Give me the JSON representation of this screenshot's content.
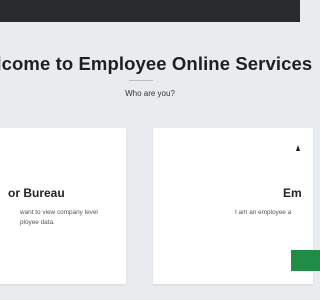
{
  "header": {
    "title": "elcome to Employee Online Services",
    "subtitle": "Who are you?"
  },
  "cards": {
    "left": {
      "heading": "or Bureau",
      "description_line1": "want to view company level",
      "description_line2": "ployee data."
    },
    "right": {
      "heading": "Em",
      "description_line1": "I am an employee a",
      "icon": "person-icon"
    }
  },
  "colors": {
    "topbar": "#282a2e",
    "background": "#e8ecee",
    "button": "#1f8d45"
  }
}
